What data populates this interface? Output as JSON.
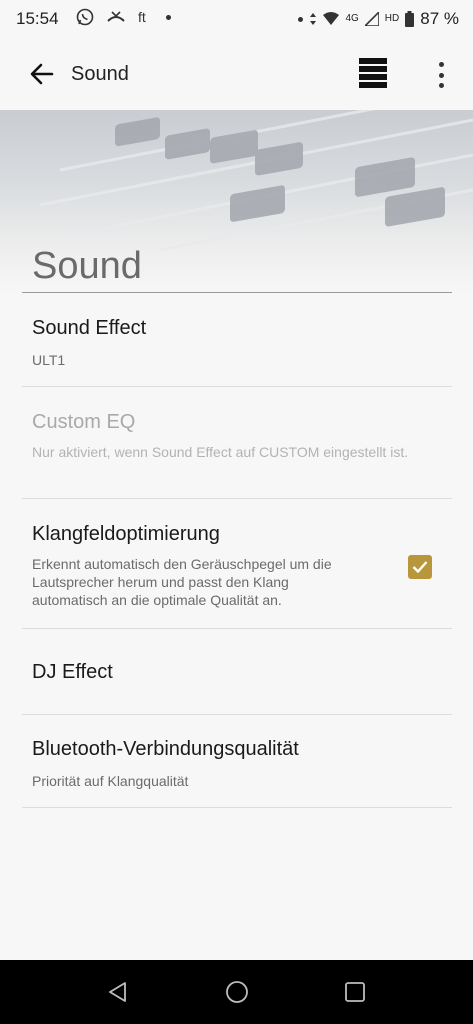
{
  "status_bar": {
    "time": "15:54",
    "left_icons": [
      "whatsapp-icon",
      "missed-call-icon",
      "ft-app-icon",
      "notification-dot"
    ],
    "network": "4G",
    "network_quality": "HD",
    "battery": "87 %"
  },
  "app_bar": {
    "title": "Sound"
  },
  "header": {
    "title": "Sound"
  },
  "settings": [
    {
      "title": "Sound Effect",
      "subtitle": "ULT1",
      "enabled": true
    },
    {
      "title": "Custom EQ",
      "subtitle": "Nur aktiviert, wenn Sound Effect auf CUSTOM eingestellt ist.",
      "enabled": false
    },
    {
      "title": "Klangfeldoptimierung",
      "subtitle": "Erkennt automatisch den Geräuschpegel um die Lautsprecher herum und passt den Klang automatisch an die optimale Qualität an.",
      "checked": true
    },
    {
      "title": "DJ Effect",
      "subtitle": ""
    },
    {
      "title": "Bluetooth-Verbindungsqualität",
      "subtitle": "Priorität auf Klangqualität"
    }
  ],
  "colors": {
    "checkbox": "#b8963c",
    "navbar": "#000000"
  }
}
